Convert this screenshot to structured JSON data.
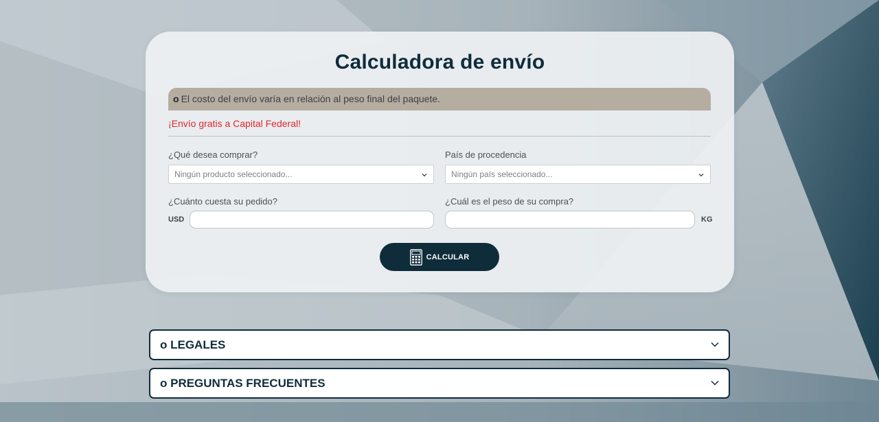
{
  "calculator": {
    "title": "Calculadora de envío",
    "notice_bullet": "o",
    "notice_text": "El costo del envío varía en relación al peso final del paquete.",
    "promo": "¡Envío gratis a Capital Federal!",
    "product": {
      "label": "¿Qué desea comprar?",
      "placeholder": "Ningún producto seleccionado..."
    },
    "country": {
      "label": "País de procedencia",
      "placeholder": "Ningún país seleccionado..."
    },
    "price": {
      "label": "¿Cuánto cuesta su pedido?",
      "unit": "USD",
      "value": ""
    },
    "weight": {
      "label": "¿Cuál es el peso de su compra?",
      "unit": "KG",
      "value": ""
    },
    "button_label": "CALCULAR",
    "button_icon": "calculator-icon"
  },
  "accordions": [
    {
      "label": "o LEGALES",
      "icon": "chevron-down-icon"
    },
    {
      "label": "o PREGUNTAS FRECUENTES",
      "icon": "chevron-down-icon"
    }
  ],
  "colors": {
    "primary": "#0f2c3b",
    "promo": "#e0262f",
    "notice_bg": "#b5ad9f",
    "card_bg": "#eef1f3"
  }
}
